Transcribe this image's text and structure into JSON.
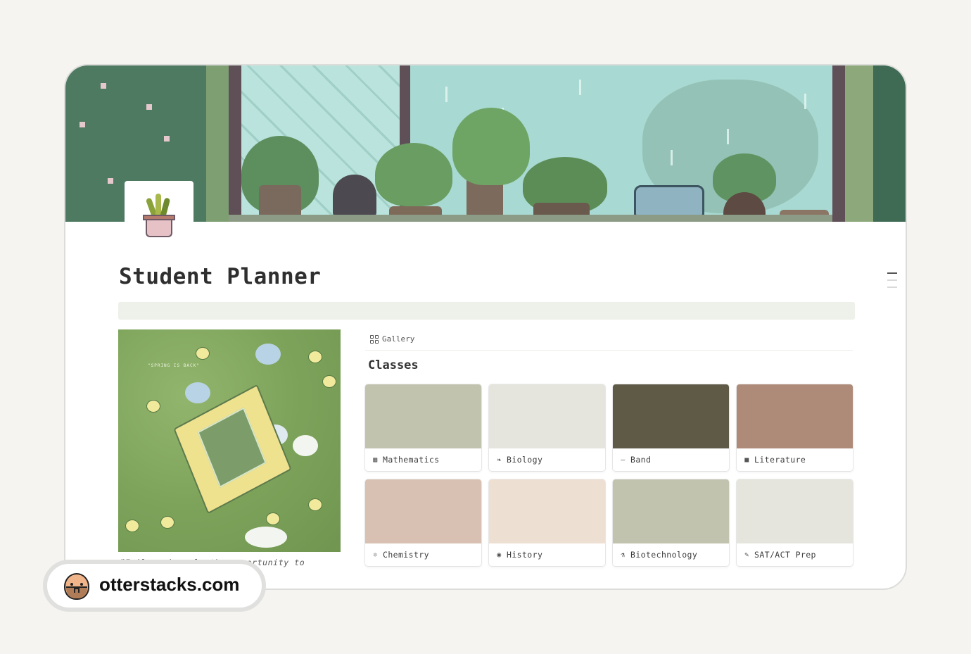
{
  "page": {
    "title": "Student Planner",
    "quote": "“Failure is only the opportunity to"
  },
  "gallery": {
    "view_label": "Gallery",
    "database_title": "Classes",
    "cards": [
      {
        "label": "Mathematics",
        "icon": "calculator-icon",
        "glyph": "▦",
        "cover_color": "#c2c3ae"
      },
      {
        "label": "Biology",
        "icon": "leaf-icon",
        "glyph": "❧",
        "cover_color": "#e5e5dd"
      },
      {
        "label": "Band",
        "icon": "flute-icon",
        "glyph": "—",
        "cover_color": "#5e5a46"
      },
      {
        "label": "Literature",
        "icon": "book-icon",
        "glyph": "■",
        "cover_color": "#ae8a78"
      },
      {
        "label": "Chemistry",
        "icon": "atom-icon",
        "glyph": "⚛",
        "cover_color": "#d8c0b3"
      },
      {
        "label": "History",
        "icon": "globe-icon",
        "glyph": "◉",
        "cover_color": "#eedfd3"
      },
      {
        "label": "Biotechnology",
        "icon": "flask-icon",
        "glyph": "⚗",
        "cover_color": "#c2c3ae"
      },
      {
        "label": "SAT/ACT Prep",
        "icon": "pencil-icon",
        "glyph": "✎",
        "cover_color": "#e5e5dd"
      }
    ]
  },
  "watermark": {
    "site": "otterstacks.com"
  }
}
